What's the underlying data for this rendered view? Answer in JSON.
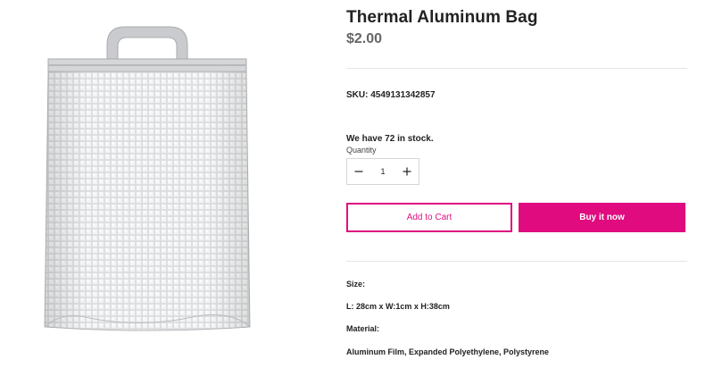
{
  "product": {
    "title": "Thermal Aluminum Bag",
    "price": "$2.00",
    "image_alt": "Thermal aluminum bag product photo"
  },
  "sku": {
    "text": "SKU: 4549131342857"
  },
  "stock": {
    "text": "We have 72 in stock.",
    "quantity_label": "Quantity",
    "quantity_value": "1"
  },
  "actions": {
    "add_to_cart": "Add to Cart",
    "buy_now": "Buy it now"
  },
  "description": {
    "size_label": "Size:",
    "size_value": "L: 28cm x W:1cm x H:38cm",
    "material_label": "Material:",
    "material_value": "Aluminum Film, Expanded Polyethylene, Polystyrene"
  },
  "colors": {
    "accent": "#e00b7f"
  }
}
